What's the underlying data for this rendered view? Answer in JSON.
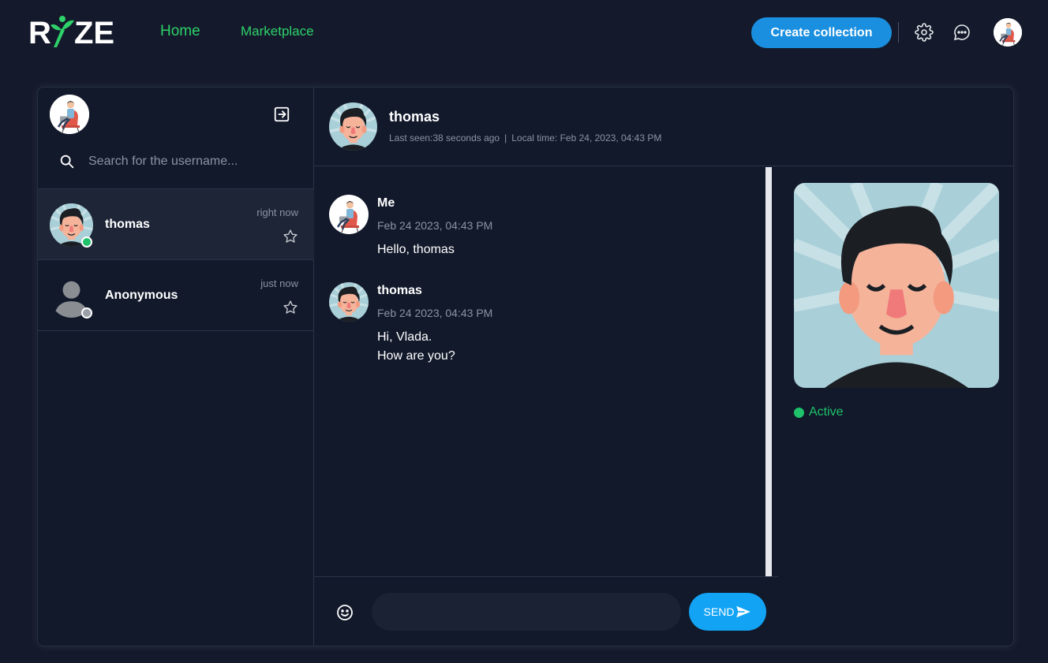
{
  "brand": {
    "logo_text": "RIZE",
    "accent": "#2ed16a"
  },
  "nav": {
    "home": "Home",
    "marketplace": "Marketplace"
  },
  "header": {
    "create_label": "Create collection",
    "create_color": "#1a8fe0"
  },
  "icons": {
    "settings": "gear-icon",
    "messages": "chat-bubble-icon",
    "logout": "logout-icon",
    "search": "search-icon",
    "star": "star-icon",
    "emoji": "emoji-icon",
    "send": "send-icon"
  },
  "sidebar": {
    "search": {
      "placeholder": "Search for the username...",
      "value": ""
    },
    "conversations": [
      {
        "name": "thomas",
        "time": "right now",
        "status": "online",
        "status_color": "#1fc26a",
        "active": true
      },
      {
        "name": "Anonymous",
        "time": "just now",
        "status": "offline",
        "status_color": "#9aa0a8",
        "active": false
      }
    ]
  },
  "chat": {
    "name": "thomas",
    "last_seen": "Last seen:38 seconds ago",
    "separator": "|",
    "local_time": "Local time: Feb 24, 2023, 04:43 PM",
    "messages": [
      {
        "author": "Me",
        "date": "Feb 24 2023, 04:43 PM",
        "lines": [
          "Hello, thomas"
        ]
      },
      {
        "author": "thomas",
        "date": "Feb 24 2023, 04:43 PM",
        "lines": [
          "Hi, Vlada.",
          "How are you?"
        ]
      }
    ],
    "composer": {
      "value": "",
      "send_label": "SEND"
    }
  },
  "profile": {
    "status": "Active",
    "status_color": "#1fc26a"
  }
}
